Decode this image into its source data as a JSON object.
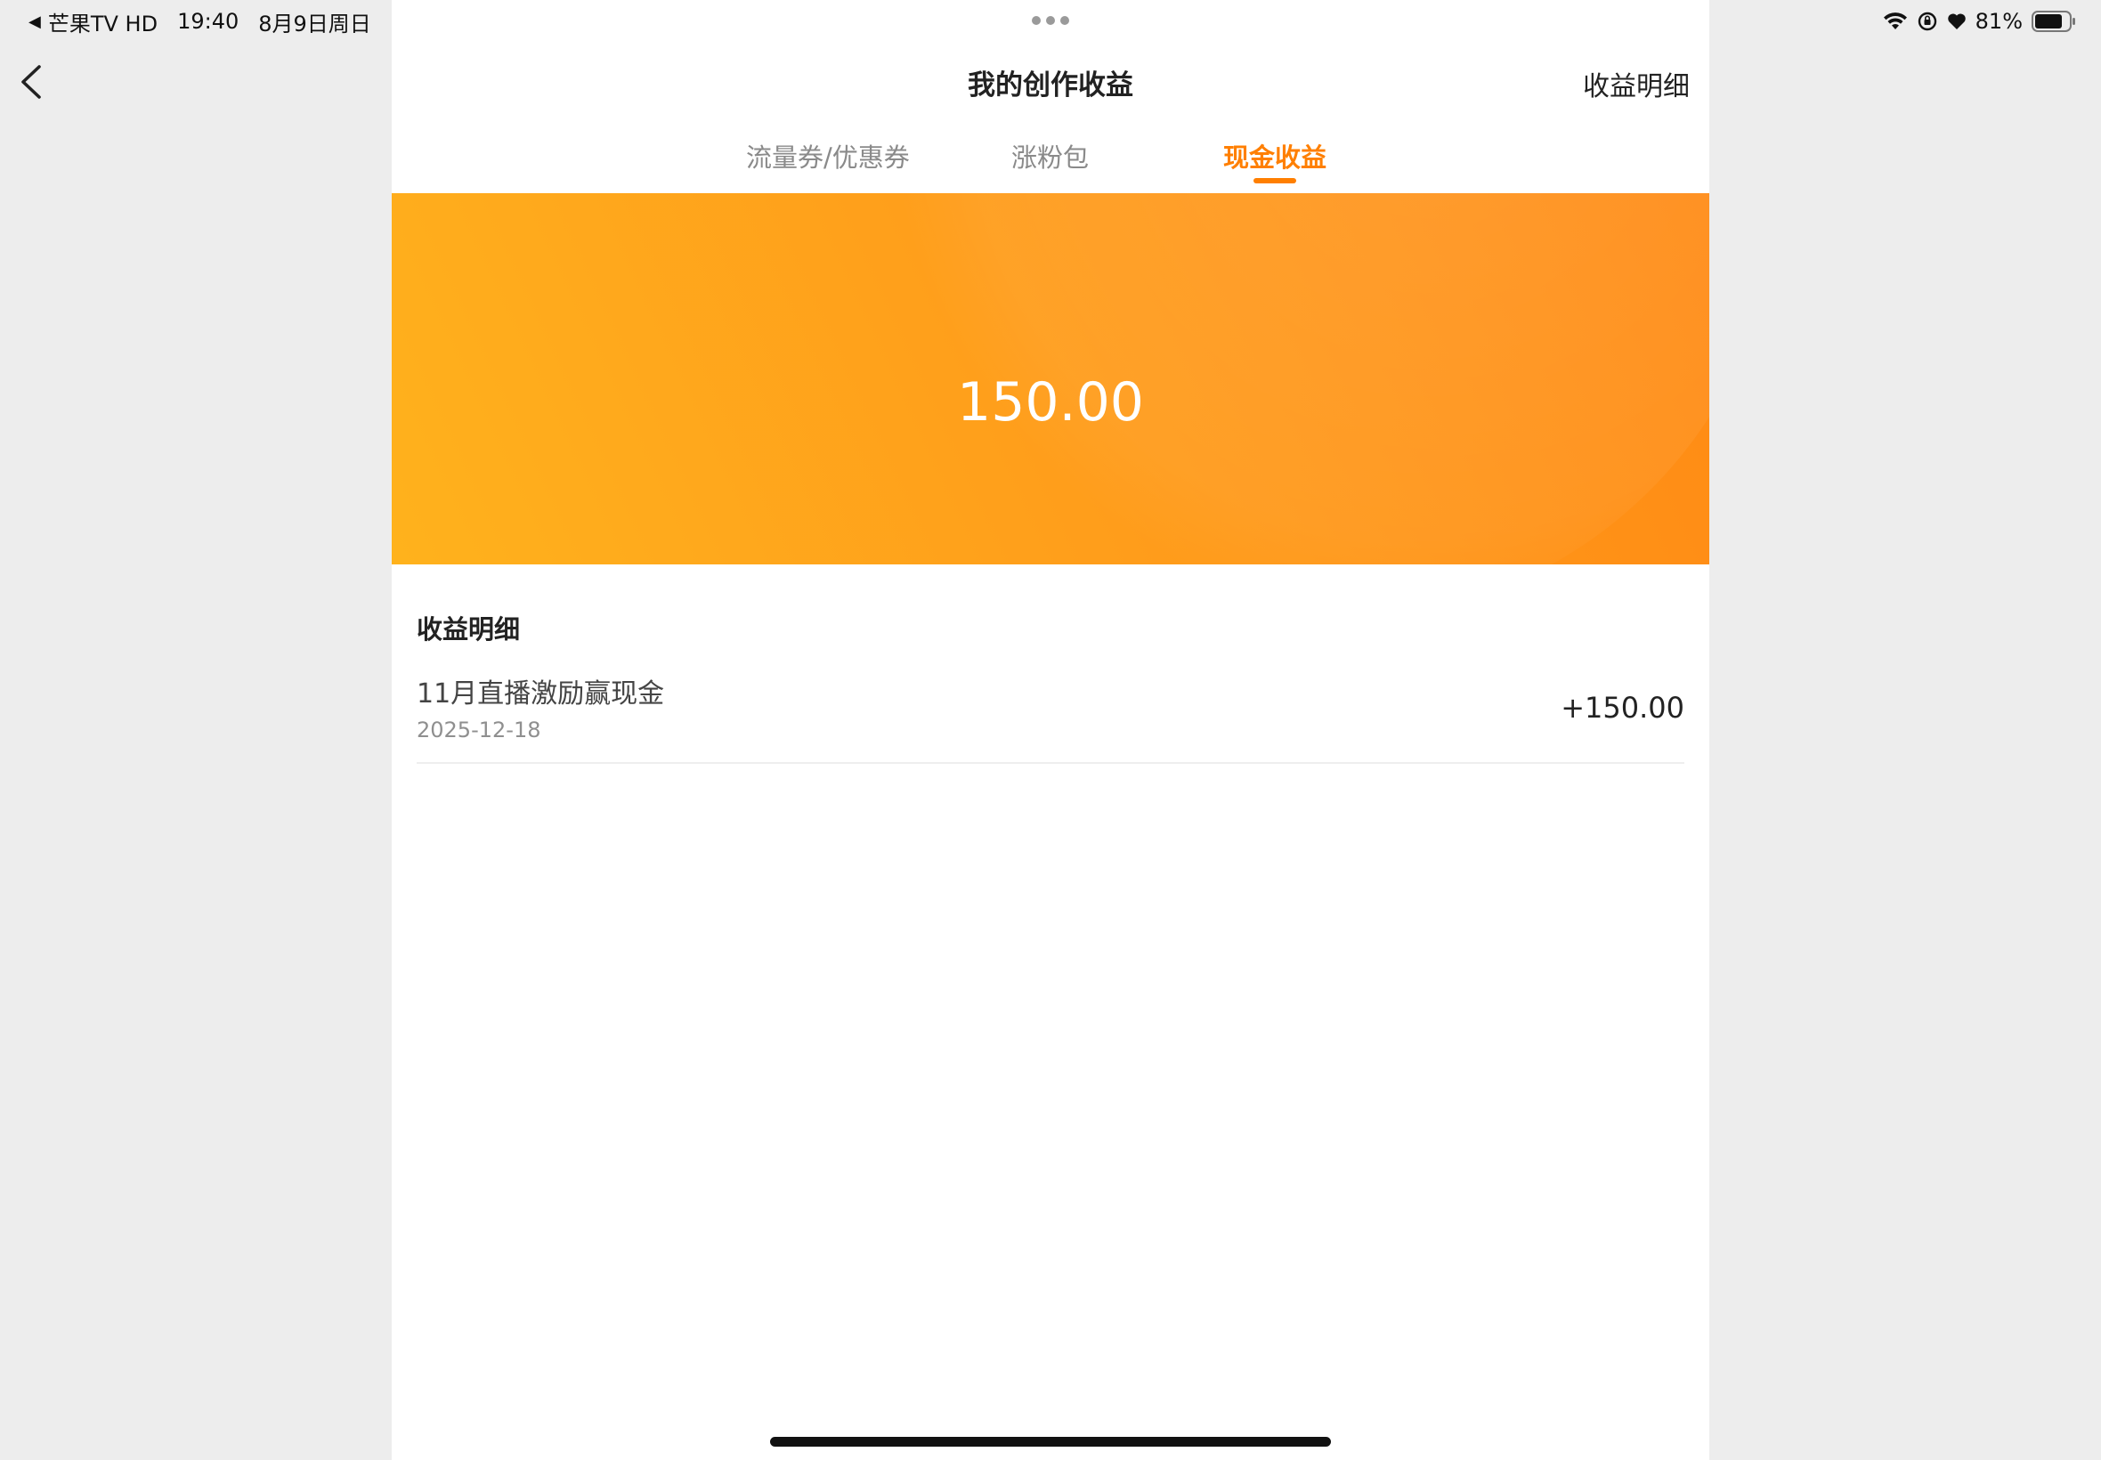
{
  "status_bar": {
    "back_app": "芒果TV HD",
    "time": "19:40",
    "date": "8月9日周日",
    "battery_percent": "81%",
    "battery_level": 0.81
  },
  "header": {
    "title": "我的创作收益",
    "detail_link": "收益明细"
  },
  "tabs": [
    {
      "label": "流量券/优惠券",
      "active": false
    },
    {
      "label": "涨粉包",
      "active": false
    },
    {
      "label": "现金收益",
      "active": true
    }
  ],
  "banner": {
    "amount": "150.00"
  },
  "earnings": {
    "section_title": "收益明细",
    "records": [
      {
        "title": "11月直播激励赢现金",
        "date": "2025-12-18",
        "amount": "+150.00"
      }
    ]
  },
  "colors": {
    "accent": "#ff7f00",
    "banner_start": "#ffb21c",
    "banner_end": "#ff8a14"
  }
}
